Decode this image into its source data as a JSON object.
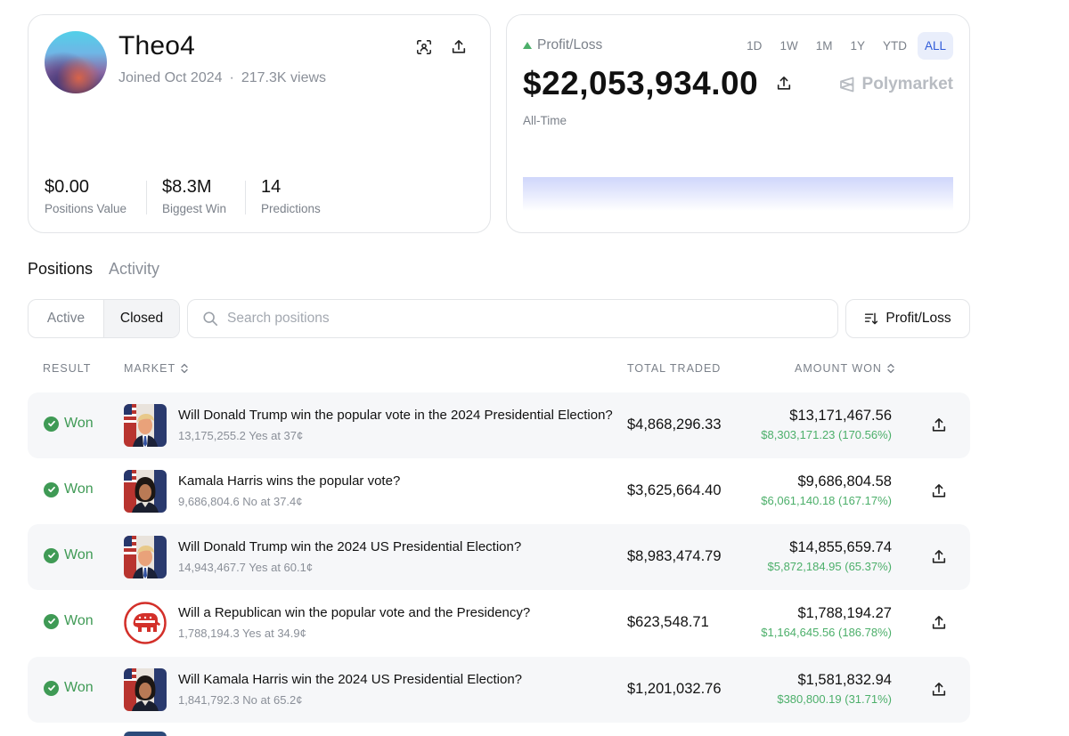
{
  "profile": {
    "username": "Theo4",
    "joined": "Joined Oct 2024",
    "separator": "·",
    "views": "217.3K views",
    "stats": [
      {
        "value": "$0.00",
        "label": "Positions Value"
      },
      {
        "value": "$8.3M",
        "label": "Biggest Win"
      },
      {
        "value": "14",
        "label": "Predictions"
      }
    ]
  },
  "pnl": {
    "label": "Profit/Loss",
    "value": "$22,053,934.00",
    "period": "All-Time",
    "brand": "Polymarket",
    "ranges": [
      "1D",
      "1W",
      "1M",
      "1Y",
      "YTD",
      "ALL"
    ],
    "active_range": "ALL"
  },
  "tabs": {
    "positions": "Positions",
    "activity": "Activity",
    "active": "Positions"
  },
  "filter": {
    "active_label": "Active",
    "closed_label": "Closed",
    "selected": "Closed"
  },
  "search": {
    "placeholder": "Search positions",
    "value": ""
  },
  "sort": {
    "label": "Profit/Loss"
  },
  "table": {
    "headers": {
      "result": "RESULT",
      "market": "MARKET",
      "total_traded": "TOTAL TRADED",
      "amount_won": "AMOUNT WON"
    },
    "rows": [
      {
        "result": "Won",
        "title": "Will Donald Trump win the popular vote in the 2024 Presidential Election?",
        "sub": "13,175,255.2 Yes at 37¢",
        "traded": "$4,868,296.33",
        "won": "$13,171,467.56",
        "gain": "$8,303,171.23 (170.56%)",
        "thumb": "trump"
      },
      {
        "result": "Won",
        "title": "Kamala Harris wins the popular vote?",
        "sub": "9,686,804.6 No at 37.4¢",
        "traded": "$3,625,664.40",
        "won": "$9,686,804.58",
        "gain": "$6,061,140.18 (167.17%)",
        "thumb": "harris"
      },
      {
        "result": "Won",
        "title": "Will Donald Trump win the 2024 US Presidential Election?",
        "sub": "14,943,467.7 Yes at 60.1¢",
        "traded": "$8,983,474.79",
        "won": "$14,855,659.74",
        "gain": "$5,872,184.95 (65.37%)",
        "thumb": "trump"
      },
      {
        "result": "Won",
        "title": "Will a Republican win the popular vote and the Presidency?",
        "sub": "1,788,194.3 Yes at 34.9¢",
        "traded": "$623,548.71",
        "won": "$1,788,194.27",
        "gain": "$1,164,645.56 (186.78%)",
        "thumb": "gop-elephant"
      },
      {
        "result": "Won",
        "title": "Will Kamala Harris win the 2024 US Presidential Election?",
        "sub": "1,841,792.3 No at 65.2¢",
        "traded": "$1,201,032.76",
        "won": "$1,581,832.94",
        "gain": "$380,800.19 (31.71%)",
        "thumb": "harris"
      }
    ]
  },
  "colors": {
    "accent": "#2f5bd9",
    "won": "#3f9a55",
    "gain": "#4caf6a",
    "muted": "#7b818a"
  }
}
